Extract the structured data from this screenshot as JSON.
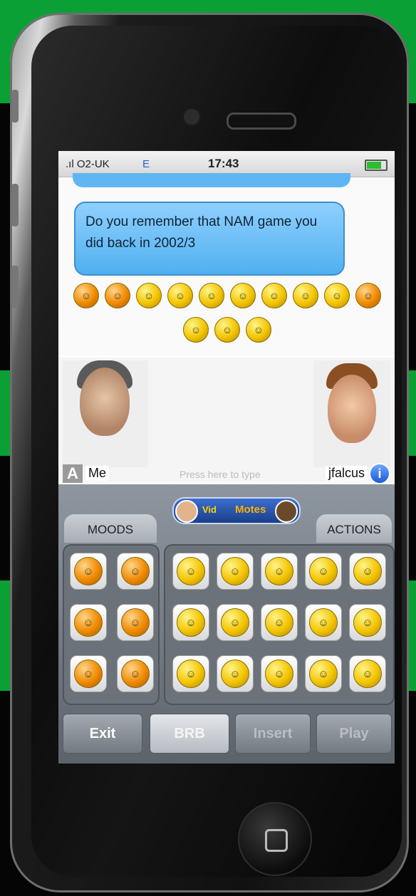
{
  "status_bar": {
    "carrier": ".ıl O2-UK",
    "network": "E",
    "time": "17:43"
  },
  "chat": {
    "message": "Do you remember that NAM game you did back in 2002/3",
    "emoticon_rows": [
      [
        "o",
        "o",
        "o",
        "o",
        "o",
        "o",
        "o",
        "o",
        "o",
        "o"
      ],
      [
        "o",
        "o",
        "o"
      ]
    ]
  },
  "video": {
    "badge": "A",
    "my_name": "Me",
    "type_hint": "Press here to type",
    "peer_name": "jfalcus",
    "info_label": "i"
  },
  "panel": {
    "logo_part1": "Vid",
    "logo_part2": "Motes",
    "tab_moods": "MOODS",
    "tab_actions": "ACTIONS"
  },
  "buttons": {
    "exit": "Exit",
    "brb": "BRB",
    "insert": "Insert",
    "play": "Play"
  },
  "colors": {
    "bubble": "#5fb6f2",
    "emoticon": "#f3c400",
    "panel": "#7a8189",
    "background_green": "#0aa035"
  }
}
